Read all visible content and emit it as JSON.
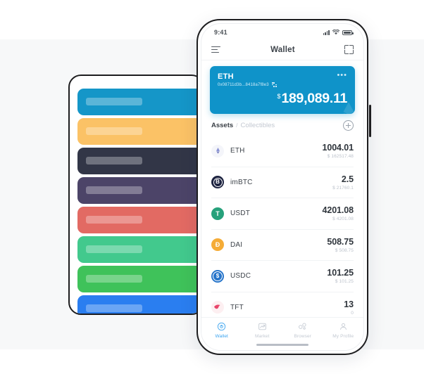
{
  "scene": {
    "background_color": "#ffffff",
    "band_color": "#f7f8f9"
  },
  "left_panel": {
    "name": "placeholder-card-stack",
    "cards": [
      {
        "color": "#1596c8",
        "watermark_icon": "ethereum-icon",
        "label": ""
      },
      {
        "color": "#fbc266",
        "watermark_icon": "bitcoin-icon",
        "label": ""
      },
      {
        "color": "#323647",
        "watermark_icon": "cosmos-atom-icon",
        "label": ""
      },
      {
        "color": "#4c4468",
        "watermark_icon": "eos-icon",
        "label": ""
      },
      {
        "color": "#e26a63",
        "watermark_icon": "tron-icon",
        "label": ""
      },
      {
        "color": "#42c98d",
        "watermark_icon": "nano-icon",
        "label": ""
      },
      {
        "color": "#3fc25a",
        "watermark_icon": "bitcoin-cash-icon",
        "label": ""
      },
      {
        "color": "#2a7ef0",
        "watermark_icon": "litecoin-icon",
        "label": ""
      }
    ]
  },
  "phone": {
    "status_bar": {
      "time": "9:41",
      "signal_icon": "cellular-signal-icon",
      "wifi_icon": "wifi-icon",
      "battery_icon": "battery-icon"
    },
    "nav": {
      "menu_icon": "menu-icon",
      "title": "Wallet",
      "scan_icon": "scan-qr-icon"
    },
    "balance_card": {
      "wallet_name": "ETH",
      "address": "0x08711d3b...8418a7f8e3",
      "qr_icon": "qr-code-icon",
      "more_icon": "more-options-icon",
      "currency_symbol": "$",
      "amount": "189,089.11",
      "accent_color": "#0f93c9",
      "watermark_icon": "ethereum-icon"
    },
    "tabs": {
      "active_label": "Assets",
      "separator": "/",
      "inactive_label": "Collectibles",
      "add_icon": "plus-circle-icon"
    },
    "assets": [
      {
        "symbol": "ETH",
        "amount": "1004.01",
        "fiat": "$ 162517.48",
        "icon": "ethereum-icon",
        "icon_bg": "#f4f5fa",
        "icon_fg": "#6f7ab8"
      },
      {
        "symbol": "imBTC",
        "amount": "2.5",
        "fiat": "$ 21760.1",
        "icon": "imbtc-icon",
        "icon_bg": "#1d2340",
        "icon_fg": "#ffffff"
      },
      {
        "symbol": "USDT",
        "amount": "4201.08",
        "fiat": "$ 4201.08",
        "icon": "tether-icon",
        "icon_bg": "#26a17b",
        "icon_fg": "#ffffff"
      },
      {
        "symbol": "DAI",
        "amount": "508.75",
        "fiat": "$ 508.75",
        "icon": "dai-icon",
        "icon_bg": "#f5ac37",
        "icon_fg": "#ffffff"
      },
      {
        "symbol": "USDC",
        "amount": "101.25",
        "fiat": "$ 101.25",
        "icon": "usd-coin-icon",
        "icon_bg": "#2775ca",
        "icon_fg": "#ffffff"
      },
      {
        "symbol": "TFT",
        "amount": "13",
        "fiat": "0",
        "icon": "tft-bird-icon",
        "icon_bg": "#fdeff1",
        "icon_fg": "#e8456a"
      }
    ],
    "tabbar": {
      "active_color": "#3aa3ef",
      "items": [
        {
          "label": "Wallet",
          "icon": "wallet-icon",
          "active": true
        },
        {
          "label": "Market",
          "icon": "market-icon",
          "active": false
        },
        {
          "label": "Browser",
          "icon": "browser-icon",
          "active": false
        },
        {
          "label": "My Profile",
          "icon": "profile-icon",
          "active": false
        }
      ]
    }
  }
}
